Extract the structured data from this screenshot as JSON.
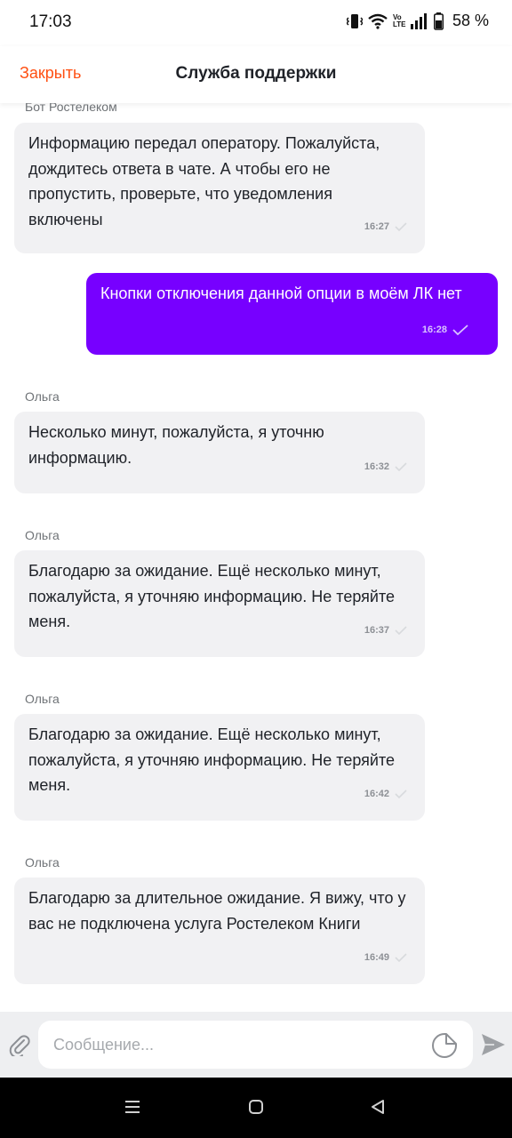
{
  "status_bar": {
    "time": "17:03",
    "battery": "58 %",
    "network": "Vo LTE"
  },
  "header": {
    "close_label": "Закрыть",
    "title": "Служба поддержки"
  },
  "messages": [
    {
      "sender": "Бот Ростелеком",
      "text": "Информацию передал оператору. Пожалуйста, дождитесь ответа в чате. А чтобы его не пропустить, проверьте, что уведомления включены",
      "time": "16:27",
      "direction": "incoming"
    },
    {
      "sender": "",
      "text": "Кнопки отключения данной опции в моём ЛК нет",
      "time": "16:28",
      "direction": "outgoing"
    },
    {
      "sender": "Ольга",
      "text": "Несколько минут, пожалуйста, я уточню информацию.",
      "time": "16:32",
      "direction": "incoming"
    },
    {
      "sender": "Ольга",
      "text": "Благодарю за ожидание. Ещё несколько минут, пожалуйста, я уточняю информацию. Не теряйте меня.",
      "time": "16:37",
      "direction": "incoming"
    },
    {
      "sender": "Ольга",
      "text": "Благодарю за ожидание. Ещё несколько минут, пожалуйста, я уточняю информацию. Не теряйте меня.",
      "time": "16:42",
      "direction": "incoming"
    },
    {
      "sender": "Ольга",
      "text": "Благодарю за длительное ожидание. Я вижу, что у вас не подключена услуга Ростелеком Книги",
      "time": "16:49",
      "direction": "incoming"
    }
  ],
  "composer": {
    "placeholder": "Сообщение..."
  },
  "icons": {
    "close": "text-link",
    "attach": "paperclip-icon",
    "sticker": "sticker-icon",
    "send": "send-icon",
    "read": "check-icon",
    "nav": [
      "recent-apps-icon",
      "home-icon",
      "back-icon"
    ]
  },
  "colors": {
    "accent": "#ff4f12",
    "outgoing_bubble": "#7700ff",
    "incoming_bubble": "#f1f1f3"
  }
}
